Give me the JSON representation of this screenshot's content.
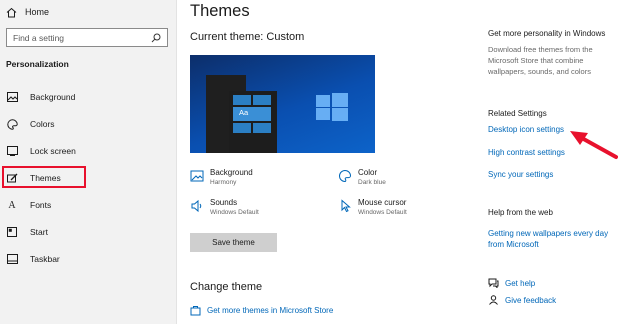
{
  "sidebar": {
    "home_label": "Home",
    "search_placeholder": "Find a setting",
    "section_heading": "Personalization",
    "items": [
      {
        "label": "Background",
        "icon": "image-icon"
      },
      {
        "label": "Colors",
        "icon": "palette-icon"
      },
      {
        "label": "Lock screen",
        "icon": "lock-screen-icon"
      },
      {
        "label": "Themes",
        "icon": "brush-icon",
        "selected": true
      },
      {
        "label": "Fonts",
        "icon": "font-icon"
      },
      {
        "label": "Start",
        "icon": "start-icon"
      },
      {
        "label": "Taskbar",
        "icon": "taskbar-icon"
      }
    ],
    "highlight_color": "#e8112d"
  },
  "main": {
    "title": "Themes",
    "current_theme": "Current theme: Custom",
    "preview_text": "Aa",
    "attributes": {
      "background": {
        "label": "Background",
        "value": "Harmony"
      },
      "color": {
        "label": "Color",
        "value": "Dark blue"
      },
      "sounds": {
        "label": "Sounds",
        "value": "Windows Default"
      },
      "mouse_cursor": {
        "label": "Mouse cursor",
        "value": "Windows Default"
      }
    },
    "save_button": "Save theme",
    "change_theme": "Change theme",
    "store_link": "Get more themes in Microsoft Store"
  },
  "right": {
    "personality_heading": "Get more personality in Windows",
    "personality_desc": "Download free themes from the Microsoft Store that combine wallpapers, sounds, and colors",
    "related_heading": "Related Settings",
    "related_links": [
      "Desktop icon settings",
      "High contrast settings",
      "Sync your settings"
    ],
    "help_heading": "Help from the web",
    "help_link": "Getting new wallpapers every day from Microsoft",
    "get_help": "Get help",
    "give_feedback": "Give feedback"
  },
  "accent_color": "#0067b8",
  "arrow_color": "#e8112d"
}
